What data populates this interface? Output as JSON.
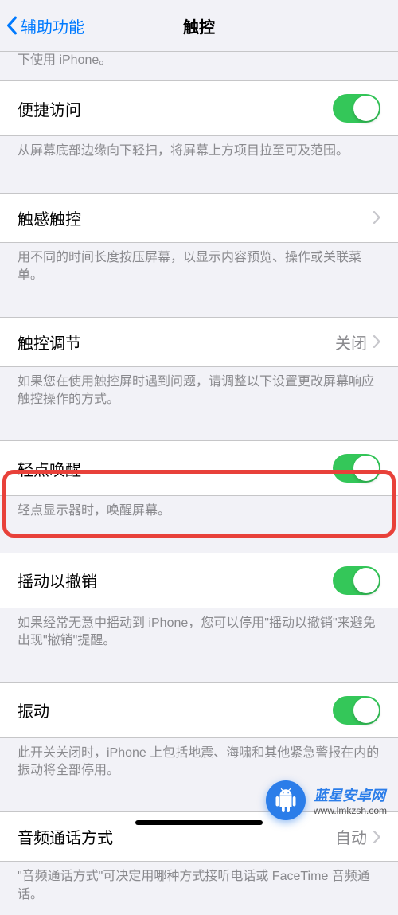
{
  "nav": {
    "back_label": "辅助功能",
    "title": "触控"
  },
  "sections": {
    "assistive_footer": "下使用 iPhone。",
    "reachability": {
      "label": "便捷访问",
      "footer": "从屏幕底部边缘向下轻扫，将屏幕上方项目拉至可及范围。"
    },
    "haptic": {
      "label": "触感触控",
      "footer": "用不同的时间长度按压屏幕，以显示内容预览、操作或关联菜单。"
    },
    "accommodations": {
      "label": "触控调节",
      "value": "关闭",
      "footer": "如果您在使用触控屏时遇到问题，请调整以下设置更改屏幕响应触控操作的方式。"
    },
    "tap_wake": {
      "label": "轻点唤醒",
      "footer": "轻点显示器时，唤醒屏幕。"
    },
    "shake_undo": {
      "label": "摇动以撤销",
      "footer": "如果经常无意中摇动到 iPhone，您可以停用\"摇动以撤销\"来避免出现\"撤销\"提醒。"
    },
    "vibration": {
      "label": "振动",
      "footer": "此开关关闭时，iPhone 上包括地震、海啸和其他紧急警报在内的振动将全部停用。"
    },
    "call_audio": {
      "label": "音频通话方式",
      "value": "自动",
      "footer": "\"音频通话方式\"可决定用哪种方式接听电话或 FaceTime 音频通话。"
    }
  },
  "watermark": {
    "title": "蓝星安卓网",
    "url": "www.lmkzsh.com"
  }
}
